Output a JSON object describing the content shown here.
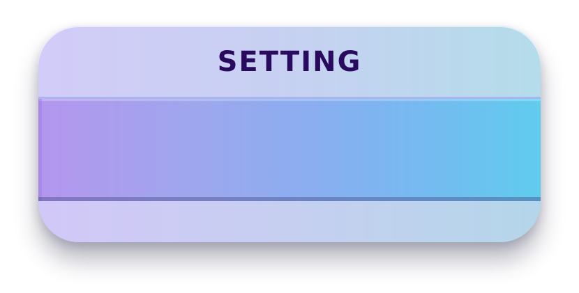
{
  "dialog": {
    "title": "SETTING"
  },
  "colors": {
    "title_text": "#2a0a5e",
    "panel_left": "#d2ccf8",
    "panel_right": "#b4dcea",
    "band_left": "#b496ee",
    "band_right": "#60ccee"
  }
}
